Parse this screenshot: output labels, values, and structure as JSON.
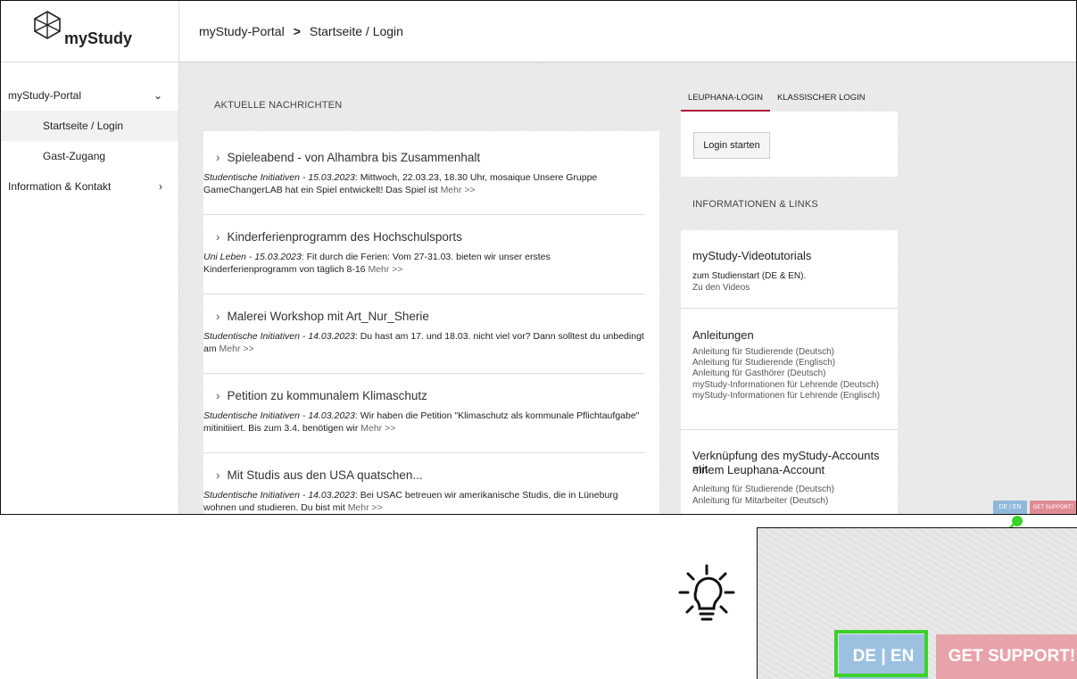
{
  "app": {
    "logo_text": "myStudy"
  },
  "breadcrumb": {
    "root": "myStudy-Portal",
    "separator": ">",
    "current": "Startseite / Login"
  },
  "sidebar": {
    "portal_label": "myStudy-Portal",
    "sub_items": [
      "Startseite / Login",
      "Gast-Zugang"
    ],
    "info_label": "Information & Kontakt"
  },
  "news": {
    "heading": "AKTUELLE NACHRICHTEN",
    "items": [
      {
        "title": "Spieleabend - von Alhambra bis Zusammenhalt",
        "source": "Studentische Initiativen - 15.03.2023",
        "text": ": Mittwoch, 22.03.23, 18.30 Uhr, mosaique Unsere Gruppe GameChangerLAB hat ein Spiel entwickelt! Das Spiel ist ",
        "more": "Mehr >>"
      },
      {
        "title": "Kinderferienprogramm des Hochschulsports",
        "source": "Uni Leben - 15.03.2023",
        "text": ": Fit durch die Ferien: Vom 27-31.03. bieten wir unser erstes Kinderferienprogramm von täglich 8-16 ",
        "more": "Mehr >>"
      },
      {
        "title": "Malerei Workshop mit Art_Nur_Sherie",
        "source": "Studentische Initiativen - 14.03.2023",
        "text": ": Du hast am 17. und 18.03. nicht viel vor? Dann solltest du unbedingt am ",
        "more": "Mehr >>"
      },
      {
        "title": "Petition zu kommunalem Klimaschutz",
        "source": "Studentische Initiativen - 14.03.2023",
        "text": ": Wir haben die Petition \"Klimaschutz als kommunale Pflichtaufgabe\" mitinitiiert. Bis zum 3.4. benötigen wir ",
        "more": "Mehr >>"
      },
      {
        "title": "Mit Studis aus den USA quatschen...",
        "source": "Studentische Initiativen - 14.03.2023",
        "text": ": Bei USAC betreuen wir amerikanische Studis, die in Lüneburg wohnen und studieren. Du bist mit ",
        "more": "Mehr >>"
      }
    ]
  },
  "login": {
    "tabs": [
      "LEUPHANA-LOGIN",
      "KLASSISCHER LOGIN"
    ],
    "start_button": "Login starten"
  },
  "info": {
    "heading": "INFORMATIONEN & LINKS",
    "video_title": "myStudy-Videotutorials",
    "video_line": "zum Studienstart (DE & EN).",
    "video_link": "Zu den Videos",
    "guides_title": "Anleitungen",
    "guides": [
      "Anleitung für Studierende (Deutsch)",
      "Anleitung für Studierende (Englisch)",
      "Anleitung für Gasthörer (Deutsch)",
      "myStudy-Informationen für Lehrende (Deutsch)",
      "myStudy-Informationen für Lehrende (Englisch)"
    ],
    "link_title_1": "Verknüpfung des myStudy-Accounts mit",
    "link_title_2": "einem Leuphana-Account",
    "link_guides": [
      "Anleitung für Studierende (Deutsch)",
      "Anleitung für Mitarbeiter (Deutsch)"
    ]
  },
  "floating": {
    "lang": "DE | EN",
    "support": "GET SUPPORT!"
  },
  "colors": {
    "accent": "#b3123a",
    "lang_button": "#8fb8db",
    "support_button": "#e08a94",
    "highlight": "#3cd22c"
  }
}
